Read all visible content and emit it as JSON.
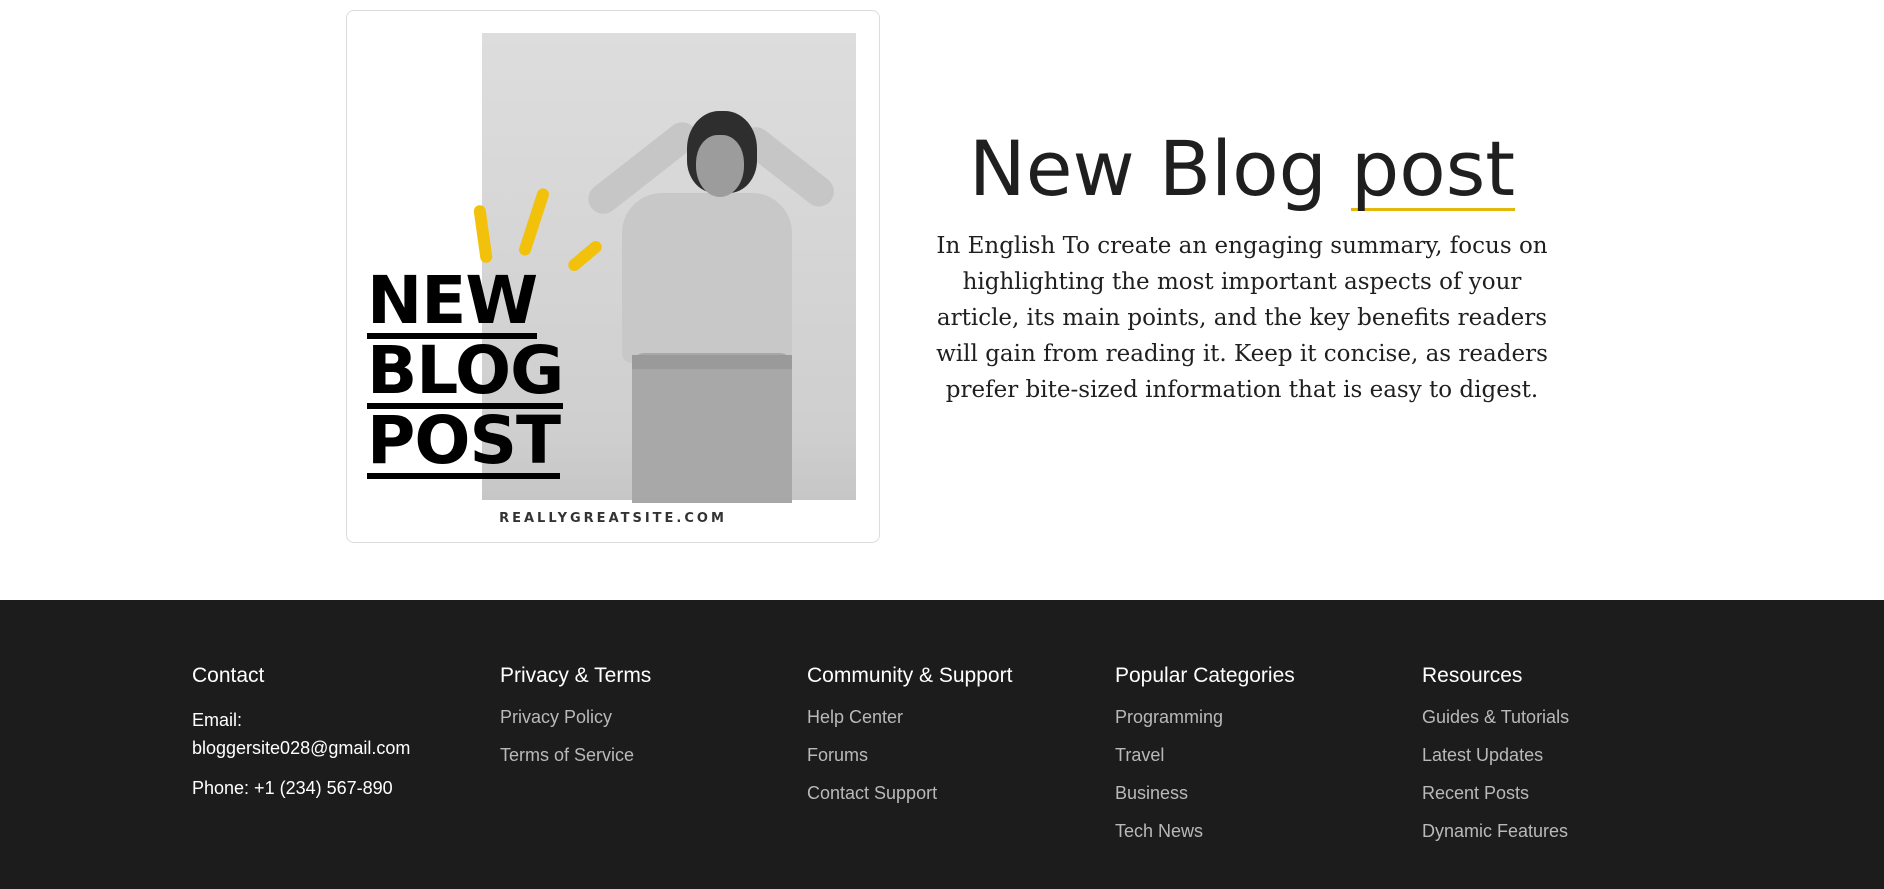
{
  "hero": {
    "cover": {
      "title_lines": [
        "NEW",
        "BLOG",
        "POST"
      ],
      "site": "REALLYGREATSITE.COM"
    },
    "heading_part1": "New Blog ",
    "heading_part2": "post",
    "summary": "In English To create an engaging summary, focus on highlighting the most important aspects of your article, its main points, and the key benefits readers will gain from reading it. Keep it concise, as readers prefer bite-sized information that is easy to digest.",
    "accent_color": "#f2c10c"
  },
  "footer": {
    "background": "#1c1c1c",
    "contact": {
      "heading": "Contact",
      "email_label": "Email:",
      "email": "bloggersite028@gmail.com",
      "phone": "Phone: +1 (234) 567-890"
    },
    "privacy": {
      "heading": "Privacy & Terms",
      "links": [
        "Privacy Policy",
        "Terms of Service"
      ]
    },
    "community": {
      "heading": "Community & Support",
      "links": [
        "Help Center",
        "Forums",
        "Contact Support"
      ]
    },
    "categories": {
      "heading": "Popular Categories",
      "links": [
        "Programming",
        "Travel",
        "Business",
        "Tech News"
      ]
    },
    "resources": {
      "heading": "Resources",
      "links": [
        "Guides & Tutorials",
        "Latest Updates",
        "Recent Posts",
        "Dynamic Features"
      ]
    }
  }
}
